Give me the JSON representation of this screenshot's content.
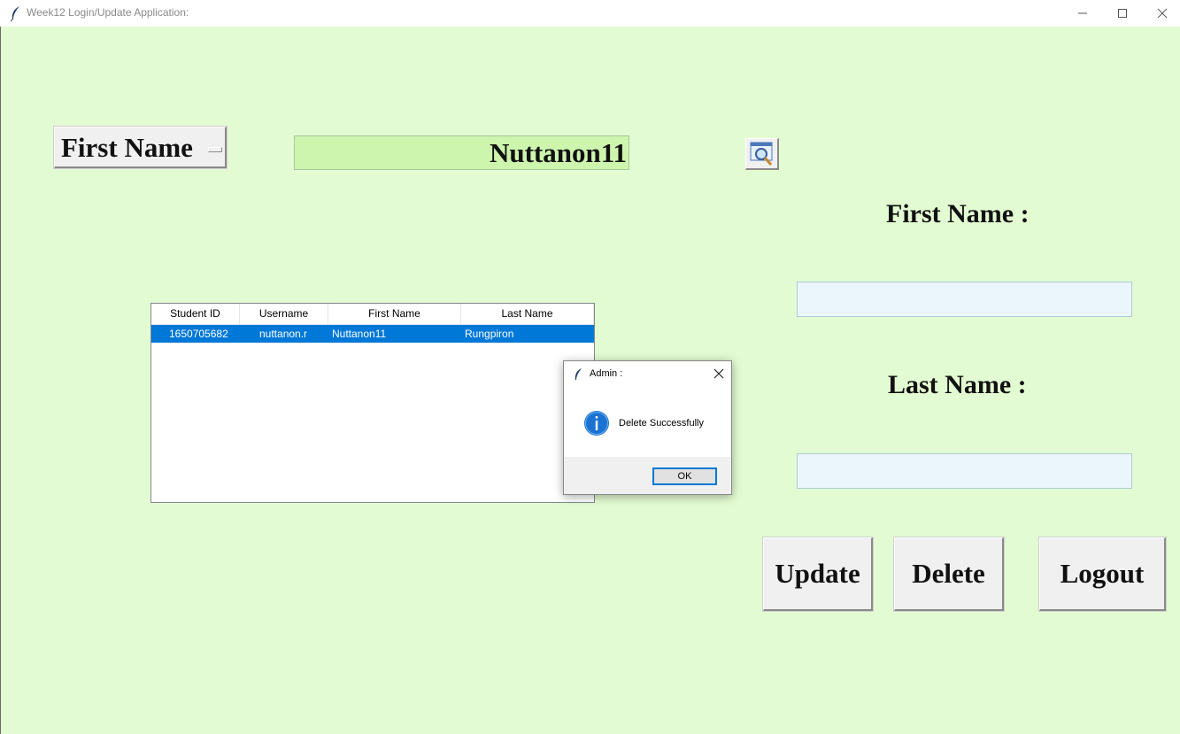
{
  "window": {
    "title": "Week12 Login/Update Application:"
  },
  "search": {
    "field_option": "First Name",
    "value": "Nuttanon11"
  },
  "form": {
    "first_name_label": "First Name :",
    "last_name_label": "Last Name :",
    "first_name_value": "",
    "last_name_value": ""
  },
  "buttons": {
    "update": "Update",
    "delete": "Delete",
    "logout": "Logout"
  },
  "table": {
    "columns": [
      "Student ID",
      "Username",
      "First Name",
      "Last Name"
    ],
    "rows": [
      [
        "1650705682",
        "nuttanon.r",
        "Nuttanon11",
        "Rungpiron"
      ]
    ]
  },
  "dialog": {
    "title": "Admin :",
    "message": "Delete Successfully",
    "ok_label": "OK"
  },
  "colors": {
    "background": "#e3fbd2",
    "search_entry": "#cdf5ae",
    "text_entry": "#ebf6fc",
    "selection": "#0078d7"
  },
  "icons": {
    "app": "feather-icon",
    "search": "magnifier-window-icon",
    "info": "info-icon"
  }
}
